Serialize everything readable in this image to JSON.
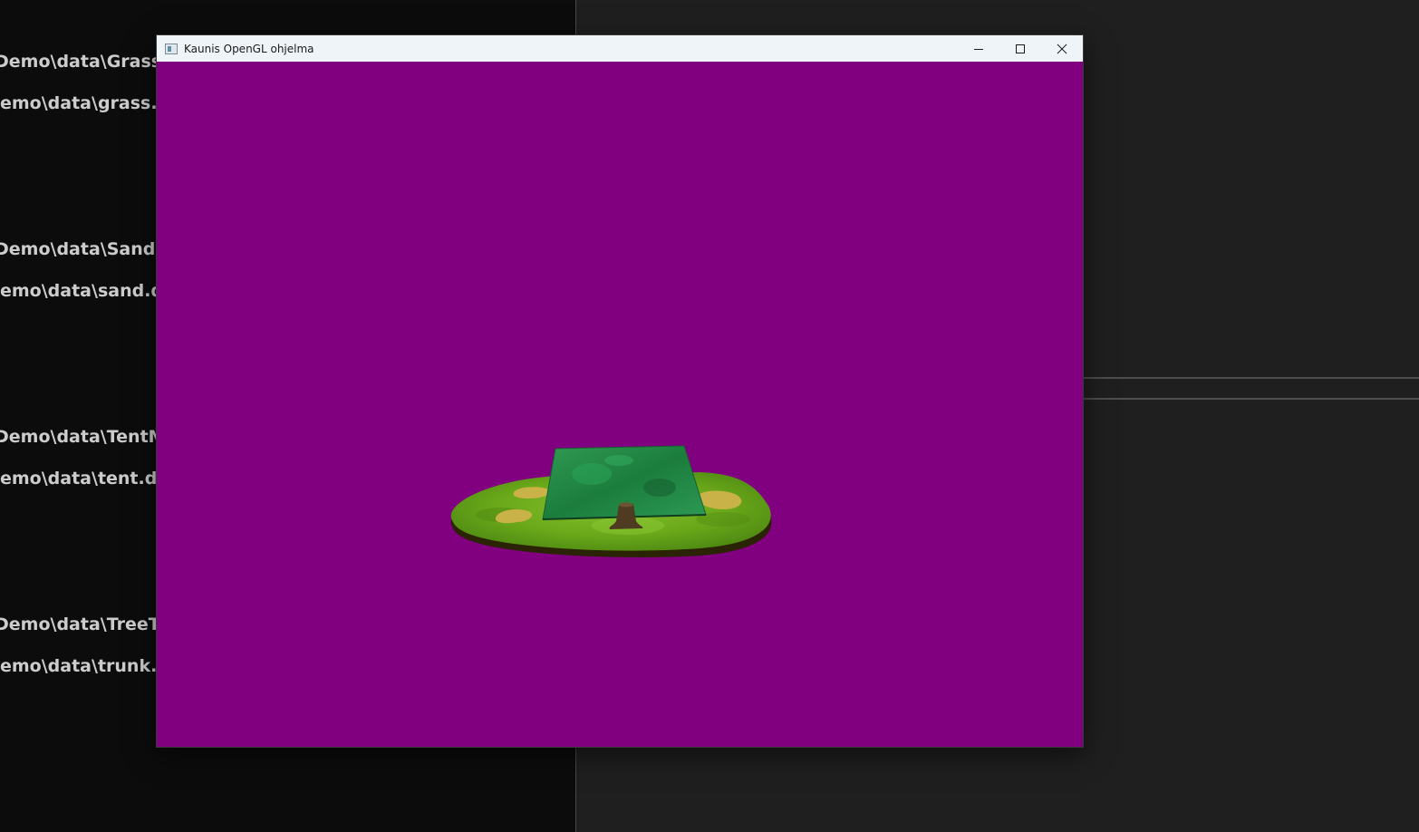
{
  "console": {
    "lines": [
      "Demo\\data\\GrassM",
      "emo\\data\\grass.d",
      "Demo\\data\\SandM",
      "emo\\data\\sand.dd",
      "Demo\\data\\TentM",
      "emo\\data\\tent.dd",
      "Demo\\data\\TreeTr",
      "emo\\data\\trunk.d"
    ]
  },
  "window": {
    "title": "Kaunis OpenGL ohjelma",
    "icon": "window-app-icon",
    "controls": [
      "minimize-icon",
      "maximize-icon",
      "close-icon"
    ],
    "client_background": "#800080"
  },
  "scene": {
    "objects": [
      "grass-island",
      "sand-patches",
      "tent",
      "tree-trunk"
    ],
    "colors": {
      "grass": "#6aa81a",
      "sand": "#c9b247",
      "tent": "#1f8a45",
      "trunk": "#4e3b21",
      "island_edge": "#2a2405"
    }
  }
}
